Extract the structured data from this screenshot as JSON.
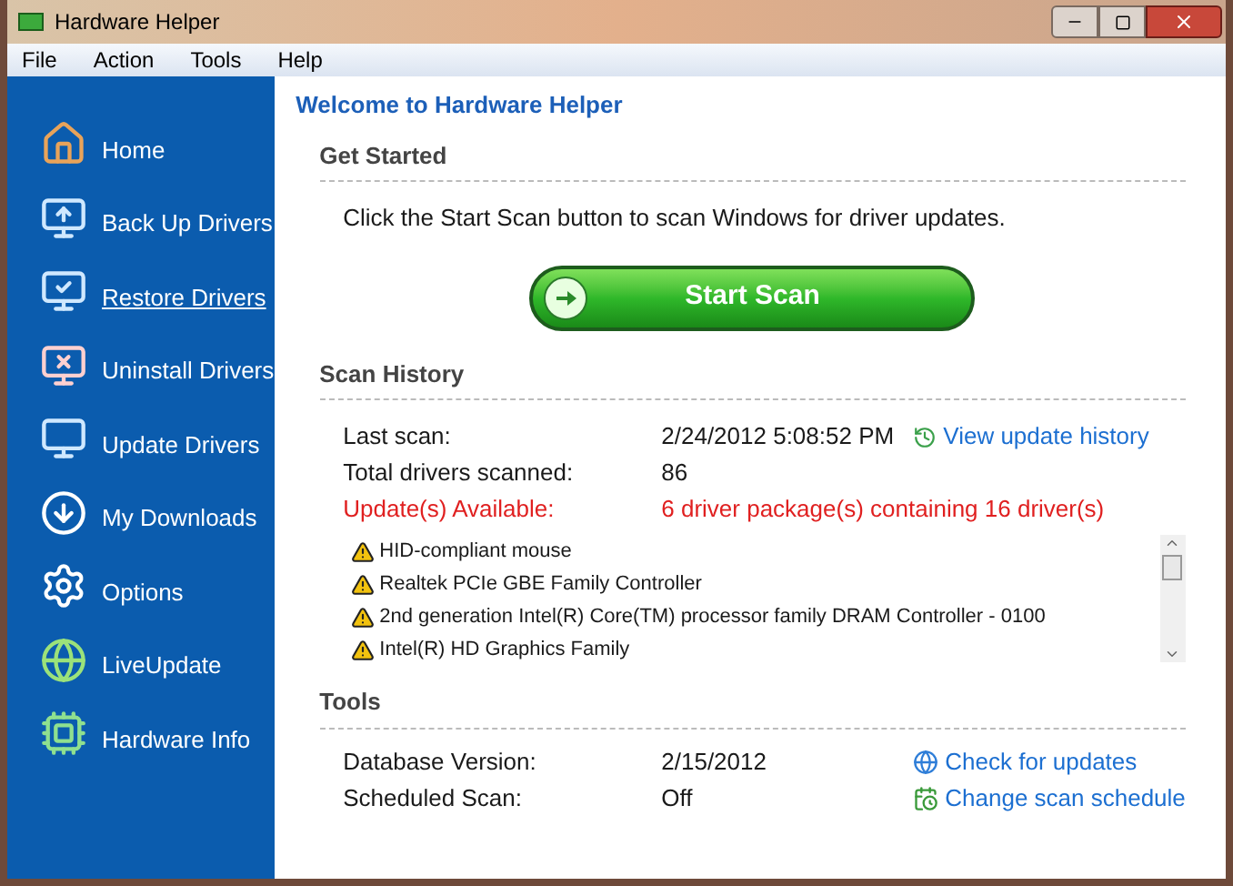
{
  "window": {
    "title": "Hardware Helper"
  },
  "menu": [
    "File",
    "Action",
    "Tools",
    "Help"
  ],
  "sidebar": {
    "items": [
      {
        "label": "Home",
        "kind": "home",
        "selected": false
      },
      {
        "label": "Back Up Drivers",
        "kind": "backup",
        "selected": false
      },
      {
        "label": "Restore Drivers",
        "kind": "restore",
        "selected": true
      },
      {
        "label": "Uninstall Drivers",
        "kind": "uninstall",
        "selected": false
      },
      {
        "label": "Update Drivers",
        "kind": "update",
        "selected": false
      },
      {
        "label": "My Downloads",
        "kind": "downloads",
        "selected": false
      },
      {
        "label": "Options",
        "kind": "options",
        "selected": false
      },
      {
        "label": "LiveUpdate",
        "kind": "liveupdate",
        "selected": false
      },
      {
        "label": "Hardware Info",
        "kind": "info",
        "selected": false
      }
    ]
  },
  "main": {
    "title": "Welcome to Hardware Helper",
    "get_started": {
      "heading": "Get Started",
      "text": "Click the Start Scan button to scan Windows for driver updates.",
      "button": "Start Scan"
    },
    "scan_history": {
      "heading": "Scan History",
      "rows": [
        {
          "label": "Last scan:",
          "value": "2/24/2012 5:08:52 PM",
          "kind": "normal",
          "link": "View update history"
        },
        {
          "label": "Total drivers scanned:",
          "value": "86",
          "kind": "normal"
        },
        {
          "label": "Update(s) Available:",
          "value": "6 driver package(s) containing 16 driver(s)",
          "kind": "alert"
        }
      ],
      "devices": [
        "HID-compliant mouse",
        "Realtek PCIe GBE Family Controller",
        "2nd generation Intel(R) Core(TM) processor family DRAM Controller - 0100",
        "Intel(R) HD Graphics Family"
      ]
    },
    "tools": {
      "heading": "Tools",
      "rows": [
        {
          "label": "Database Version:",
          "value": "2/15/2012",
          "link": "Check for updates"
        },
        {
          "label": "Scheduled Scan:",
          "value": "Off",
          "link": "Change scan schedule"
        }
      ]
    }
  }
}
